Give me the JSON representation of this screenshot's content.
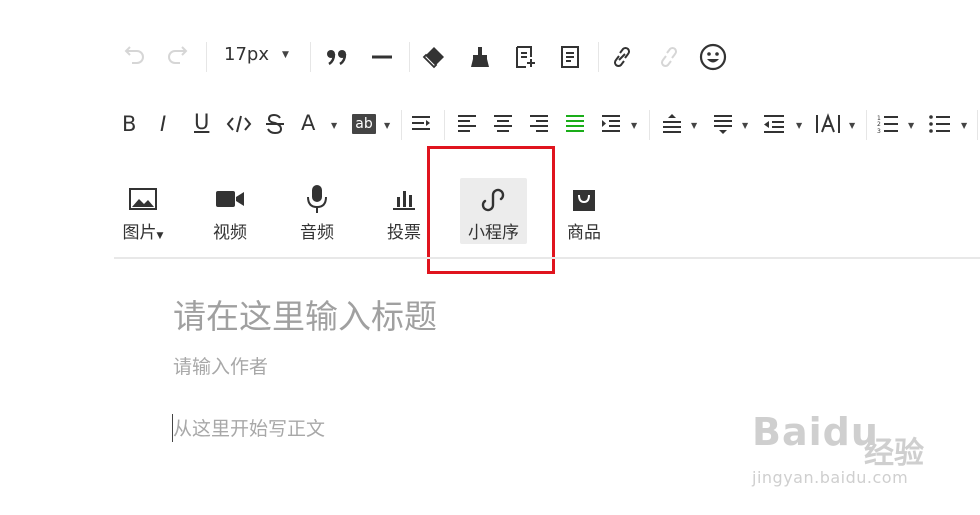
{
  "toolbar": {
    "font_size": "17px",
    "format_letters": {
      "bold": "B",
      "italic": "I",
      "underline": "U",
      "font_color": "A",
      "bg_color": "ab"
    }
  },
  "media_bar": {
    "items": [
      {
        "label": "图片",
        "icon": "image-icon",
        "has_caret": true
      },
      {
        "label": "视频",
        "icon": "video-icon"
      },
      {
        "label": "音频",
        "icon": "microphone-icon"
      },
      {
        "label": "投票",
        "icon": "poll-icon"
      },
      {
        "label": "小程序",
        "icon": "miniprogram-link-icon",
        "active": true
      },
      {
        "label": "商品",
        "icon": "shopping-bag-icon"
      }
    ]
  },
  "editor": {
    "title_placeholder": "请在这里输入标题",
    "author_placeholder": "请输入作者",
    "body_placeholder": "从这里开始写正文"
  },
  "watermark": {
    "brand": "Baidu",
    "brand_cn": "经验",
    "url": "jingyan.baidu.com"
  },
  "colors": {
    "highlight": "#e0141e",
    "align_justify_active": "#1aad19",
    "placeholder": "#a0a0a0"
  }
}
